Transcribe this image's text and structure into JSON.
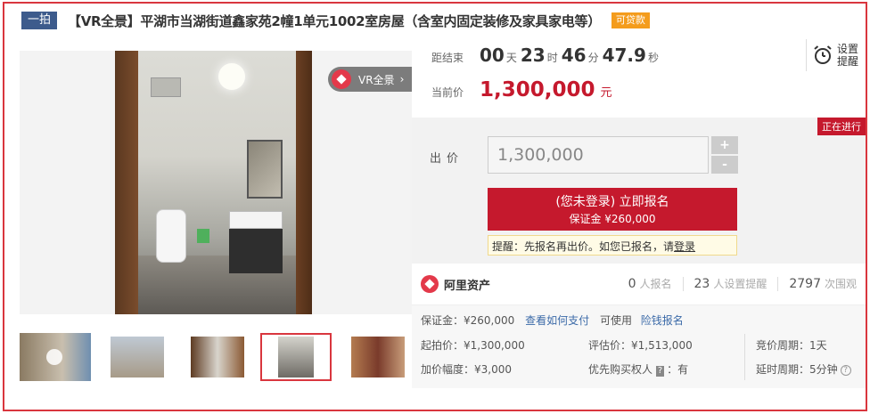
{
  "header": {
    "tag": "一拍",
    "title": "【VR全景】平湖市当湖街道鑫家苑2幢1单元1002室房屋（含室内固定装修及家具家电等）",
    "loan_tag": "可贷款"
  },
  "gallery": {
    "vr_label": "VR全景",
    "vr_arrow": "›",
    "active_thumb": 4
  },
  "countdown": {
    "label": "距结束",
    "days": "00",
    "days_unit": "天",
    "hours": "23",
    "hours_unit": "时",
    "minutes": "46",
    "minutes_unit": "分",
    "seconds": "47.9",
    "seconds_unit": "秒"
  },
  "remind": {
    "line1": "设置",
    "line2": "提醒"
  },
  "current_price": {
    "label": "当前价",
    "value": "1,300,000",
    "unit": "元"
  },
  "bid": {
    "status": "正在进行",
    "label": "出价",
    "input_value": "1,300,000",
    "plus": "+",
    "minus": "-",
    "signup_line1": "(您未登录) 立即报名",
    "signup_line2": "保证金 ¥260,000",
    "tip_text": "提醒：先报名再出价。如您已报名，请",
    "tip_link": "登录"
  },
  "platform": {
    "name": "阿里资产",
    "signups": "0",
    "signups_unit": "人报名",
    "reminders": "23",
    "reminders_unit": "人设置提醒",
    "views": "2797",
    "views_unit": "次围观"
  },
  "details": {
    "deposit": "保证金：¥260,000",
    "how_to_pay": "查看如何支付",
    "usable": "可使用",
    "credit_signup": "险钱报名",
    "start_price": "起拍价：¥1,300,000",
    "increment": "加价幅度：¥3,000",
    "appraisal": "评估价：¥1,513,000",
    "priority_label": "优先购买权人",
    "priority_badge": "?",
    "priority_value": "：有",
    "bid_cycle": "竞价周期：1天",
    "delay_cycle": "延时周期：5分钟",
    "help_mark": "?"
  },
  "colors": {
    "accent": "#c5192d",
    "tag_blue": "#3d5b8c",
    "loan_orange": "#f49c1c",
    "link": "#3b6aa8"
  }
}
